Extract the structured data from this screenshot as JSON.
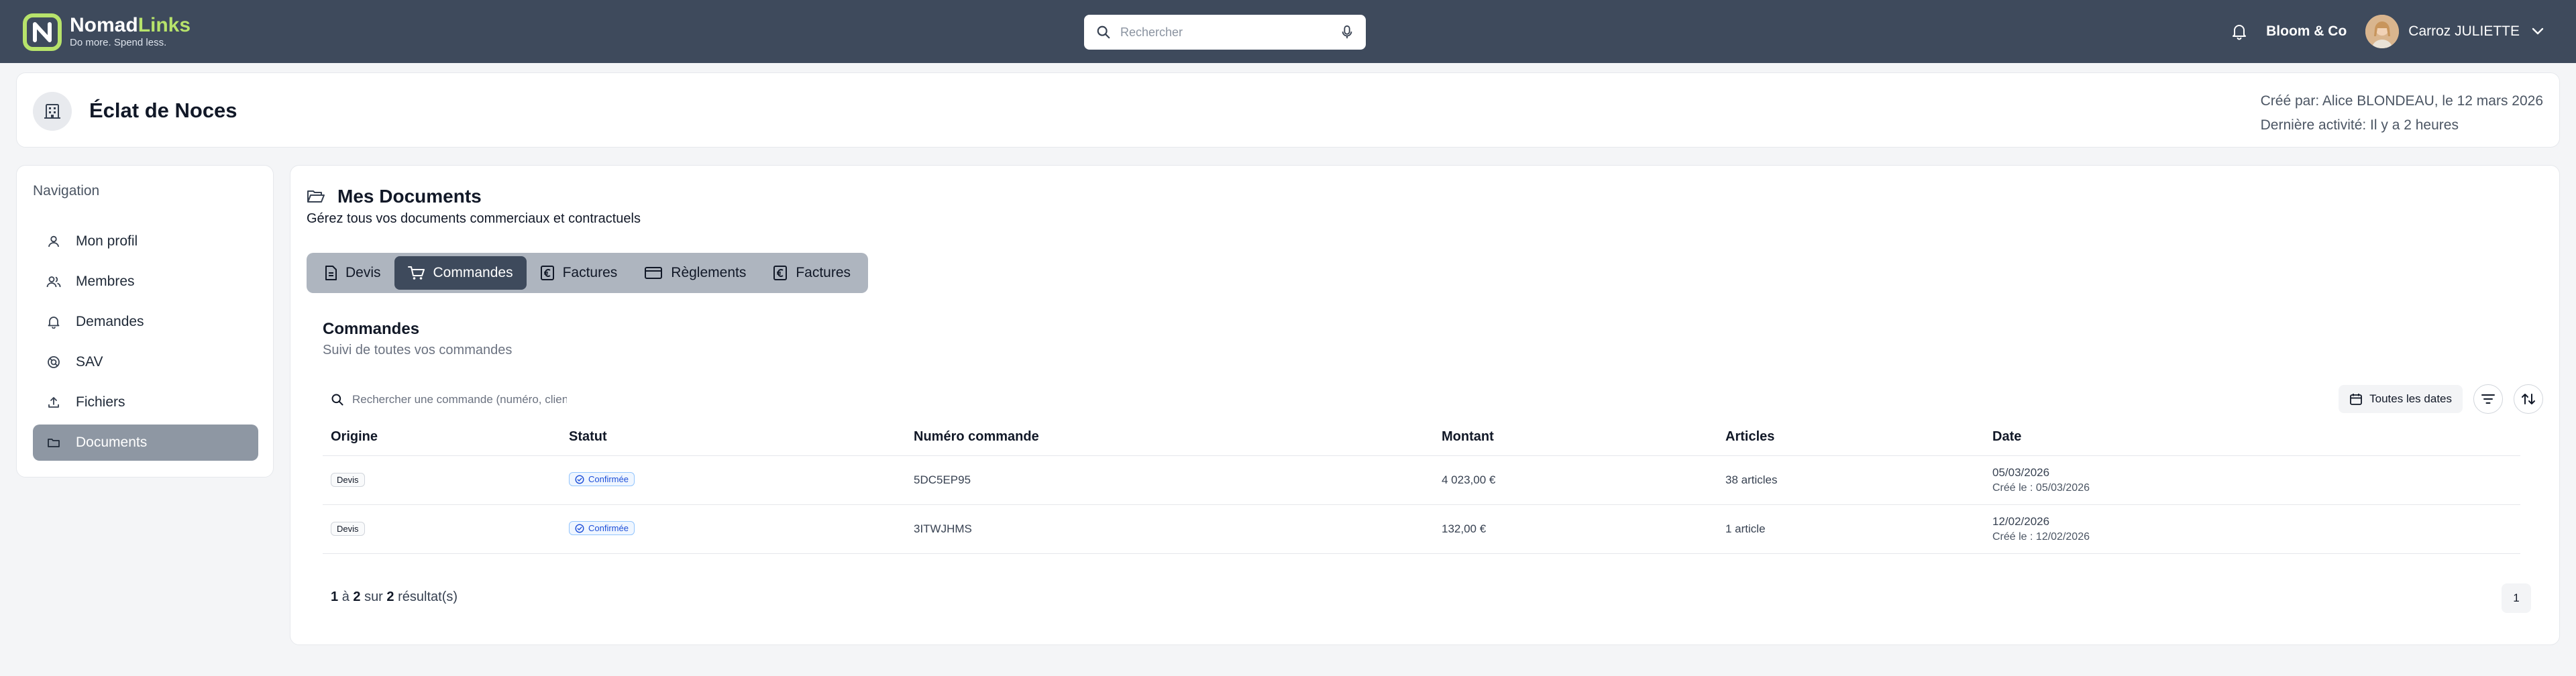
{
  "brand": {
    "name_part1": "Nomad",
    "name_part2": "Links",
    "tagline": "Do more. Spend less."
  },
  "search": {
    "placeholder": "Rechercher"
  },
  "topbar": {
    "organization": "Bloom & Co",
    "user_name": "Carroz JULIETTE"
  },
  "entity": {
    "title": "Éclat de Noces",
    "created_by": "Créé par: Alice BLONDEAU, le 12 mars 2026",
    "last_activity": "Dernière activité: Il y a 2 heures"
  },
  "navigation": {
    "heading": "Navigation",
    "items": [
      {
        "label": "Mon profil",
        "icon": "user-icon"
      },
      {
        "label": "Membres",
        "icon": "users-icon"
      },
      {
        "label": "Demandes",
        "icon": "bell-icon"
      },
      {
        "label": "SAV",
        "icon": "support-icon"
      },
      {
        "label": "Fichiers",
        "icon": "upload-icon"
      },
      {
        "label": "Documents",
        "icon": "folder-icon",
        "active": true
      }
    ]
  },
  "documents": {
    "title": "Mes Documents",
    "subtitle": "Gérez tous vos documents commerciaux et contractuels",
    "tabs": [
      {
        "label": "Devis",
        "icon": "file-icon"
      },
      {
        "label": "Commandes",
        "icon": "cart-icon",
        "active": true
      },
      {
        "label": "Factures",
        "icon": "euro-icon"
      },
      {
        "label": "Règlements",
        "icon": "card-icon"
      },
      {
        "label": "Factures",
        "icon": "euro-icon"
      }
    ]
  },
  "orders": {
    "title": "Commandes",
    "subtitle": "Suivi de toutes vos commandes",
    "search_placeholder": "Rechercher une commande (numéro, client...)",
    "date_filter": "Toutes les dates",
    "columns": [
      "Origine",
      "Statut",
      "Numéro commande",
      "Montant",
      "Articles",
      "Date"
    ],
    "rows": [
      {
        "origin": "Devis",
        "status": "Confirmée",
        "number": "5DC5EP95",
        "amount": "4 023,00 €",
        "articles": "38 articles",
        "date": "05/03/2026",
        "created": "Créé le : 05/03/2026"
      },
      {
        "origin": "Devis",
        "status": "Confirmée",
        "number": "3ITWJHMS",
        "amount": "132,00 €",
        "articles": "1 article",
        "date": "12/02/2026",
        "created": "Créé le : 12/02/2026"
      }
    ],
    "pagination": {
      "from": "1",
      "to_word": "à",
      "to": "2",
      "of_word": "sur",
      "total": "2",
      "suffix": "résultat(s)",
      "current_page": "1"
    }
  },
  "colors": {
    "topbar": "#3e4a5c",
    "accent_green": "#b7e36b",
    "active_nav": "#8e97a3",
    "status_blue": "#1d4ed8"
  }
}
